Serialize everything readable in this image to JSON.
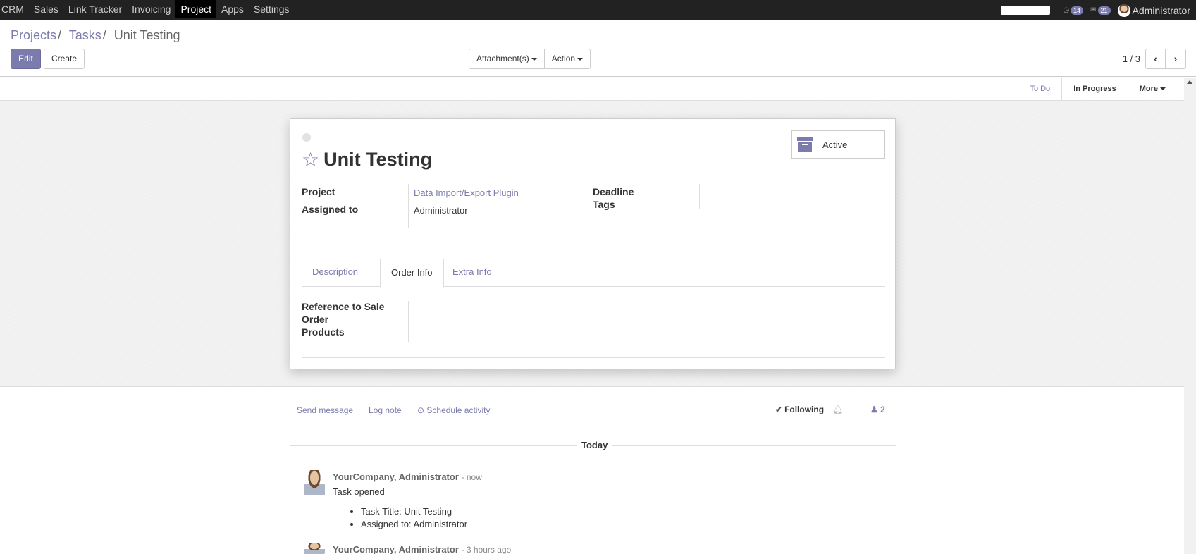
{
  "topbar": {
    "menu": [
      "CRM",
      "Sales",
      "Link Tracker",
      "Invoicing",
      "Project",
      "Apps",
      "Settings"
    ],
    "active_menu": "Project",
    "activity_count": "14",
    "message_count": "21",
    "user_name": "Administrator"
  },
  "breadcrumb": {
    "projects": "Projects",
    "tasks": "Tasks",
    "current": "Unit Testing",
    "separator": "/"
  },
  "toolbar": {
    "edit_label": "Edit",
    "create_label": "Create",
    "attachments_label": "Attachment(s)",
    "action_label": "Action",
    "pager_value": "1 / 3"
  },
  "stages": {
    "todo": "To Do",
    "in_progress": "In Progress",
    "more": "More"
  },
  "task": {
    "title": "Unit Testing",
    "active_label": "Active",
    "fields": {
      "project_label": "Project",
      "project_value": "Data Import/Export Plugin",
      "assigned_label": "Assigned to",
      "assigned_value": "Administrator",
      "deadline_label": "Deadline",
      "tags_label": "Tags"
    },
    "tabs": [
      "Description",
      "Order Info",
      "Extra Info"
    ],
    "active_tab": "Order Info",
    "order_info": {
      "ref_label_1": "Reference to Sale",
      "ref_label_2": "Order",
      "products_label": "Products"
    }
  },
  "chatter": {
    "send_message": "Send message",
    "log_note": "Log note",
    "schedule_activity": "Schedule activity",
    "following": "Following",
    "followers_count": "2",
    "today": "Today",
    "messages": [
      {
        "author": "YourCompany, Administrator",
        "time": "- now",
        "body": "Task opened",
        "items": [
          "Task Title: Unit Testing",
          "Assigned to: Administrator"
        ]
      },
      {
        "author": "YourCompany, Administrator",
        "time": "- 3 hours ago"
      }
    ]
  },
  "colors": {
    "accent": "#7c7bad",
    "topbar": "#222222"
  }
}
